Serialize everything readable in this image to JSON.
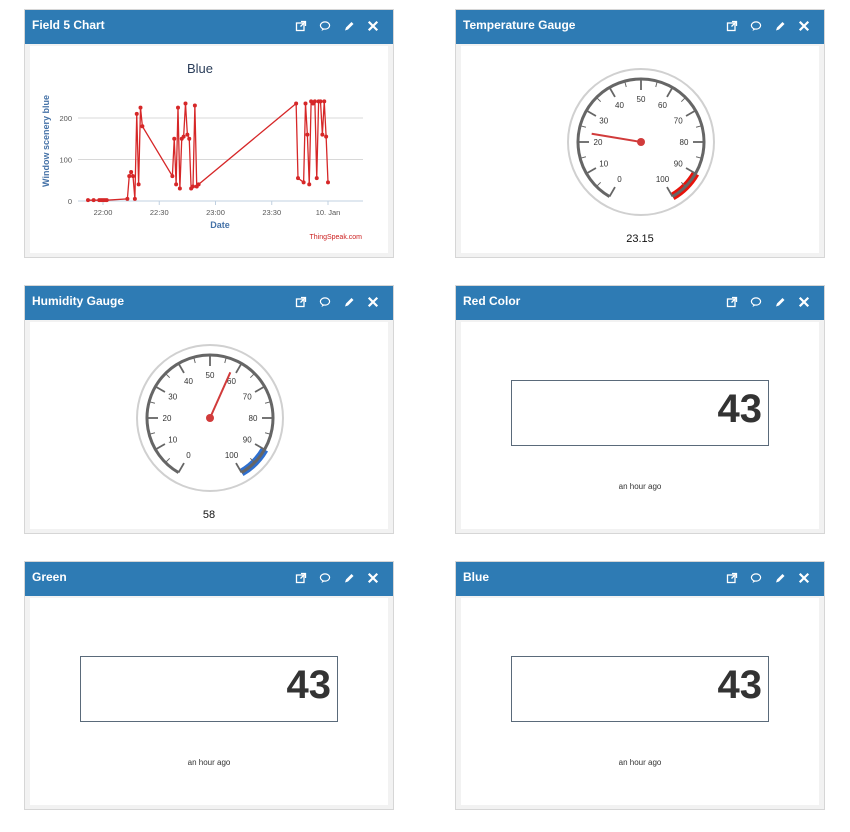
{
  "widgets": {
    "chart": {
      "title": "Field 5 Chart",
      "chart_title": "Blue",
      "ylabel": "Window scenery blue",
      "xlabel": "Date",
      "credit": "ThingSpeak.com",
      "y_ticks": [
        "0",
        "100",
        "200"
      ],
      "x_ticks": [
        "22:00",
        "22:30",
        "23:00",
        "23:30",
        "10. Jan"
      ]
    },
    "temp": {
      "title": "Temperature Gauge",
      "value": "23.15"
    },
    "humidity": {
      "title": "Humidity Gauge",
      "value": "58"
    },
    "red": {
      "title": "Red Color",
      "value": "43",
      "time": "an hour ago"
    },
    "green": {
      "title": "Green",
      "value": "43",
      "time": "an hour ago"
    },
    "blue": {
      "title": "Blue",
      "value": "43",
      "time": "an hour ago"
    }
  },
  "icons": [
    "external-link-icon",
    "comment-icon",
    "pencil-icon",
    "close-icon"
  ],
  "gauge_ticks": [
    "0",
    "10",
    "20",
    "30",
    "40",
    "50",
    "60",
    "70",
    "80",
    "90",
    "100"
  ],
  "chart_data": {
    "type": "line",
    "title": "Blue",
    "xlabel": "Date",
    "ylabel": "Window scenery blue",
    "x_ticks": [
      "22:00",
      "22:30",
      "23:00",
      "23:30",
      "10. Jan"
    ],
    "ylim": [
      0,
      250
    ],
    "series": [
      {
        "name": "",
        "points": [
          [
            "21:52",
            2
          ],
          [
            "21:55",
            2
          ],
          [
            "21:58",
            2
          ],
          [
            "21:59",
            2
          ],
          [
            "22:00",
            2
          ],
          [
            "22:01",
            2
          ],
          [
            "22:02",
            2
          ],
          [
            "22:13",
            5
          ],
          [
            "22:14",
            60
          ],
          [
            "22:15",
            70
          ],
          [
            "22:16",
            60
          ],
          [
            "22:17",
            5
          ],
          [
            "22:18",
            210
          ],
          [
            "22:19",
            40
          ],
          [
            "22:20",
            225
          ],
          [
            "22:21",
            180
          ],
          [
            "22:37",
            60
          ],
          [
            "22:38",
            150
          ],
          [
            "22:39",
            40
          ],
          [
            "22:40",
            225
          ],
          [
            "22:41",
            30
          ],
          [
            "22:42",
            150
          ],
          [
            "22:43",
            155
          ],
          [
            "22:44",
            235
          ],
          [
            "22:45",
            160
          ],
          [
            "22:46",
            150
          ],
          [
            "22:47",
            30
          ],
          [
            "22:48",
            35
          ],
          [
            "22:49",
            230
          ],
          [
            "22:50",
            35
          ],
          [
            "22:51",
            40
          ],
          [
            "23:43",
            235
          ],
          [
            "23:44",
            55
          ],
          [
            "23:47",
            45
          ],
          [
            "23:48",
            235
          ],
          [
            "23:49",
            160
          ],
          [
            "23:50",
            40
          ],
          [
            "23:51",
            240
          ],
          [
            "23:52",
            235
          ],
          [
            "23:53",
            240
          ],
          [
            "23:54",
            55
          ],
          [
            "23:55",
            240
          ],
          [
            "23:56",
            240
          ],
          [
            "23:57",
            160
          ],
          [
            "23:58",
            240
          ],
          [
            "23:59",
            155
          ],
          [
            "00:00",
            45
          ]
        ]
      }
    ]
  },
  "gauges": [
    {
      "name": "temperature",
      "value": 23.15,
      "min": 0,
      "max": 100,
      "band": {
        "from": 90,
        "to": 100,
        "color": "#e8120a"
      }
    },
    {
      "name": "humidity",
      "value": 58,
      "min": 0,
      "max": 100,
      "band": {
        "from": 90,
        "to": 100,
        "color": "#2e6fcf"
      }
    }
  ]
}
